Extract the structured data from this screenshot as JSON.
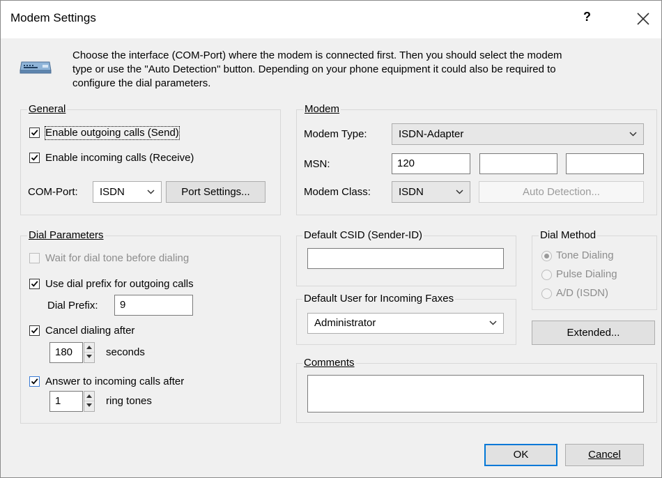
{
  "window": {
    "title": "Modem Settings",
    "help": "?"
  },
  "intro": {
    "icon": "modem-icon",
    "line1": "Choose the interface (COM-Port) where the modem is connected first. Then you should select the modem",
    "line2": "type or use the \"Auto Detection\" button. Depending on your phone equipment it could also be required to",
    "line3": "configure the dial parameters."
  },
  "general": {
    "legend": "General",
    "enable_outgoing": {
      "label": "Enable outgoing calls (Send)",
      "checked": true
    },
    "enable_incoming": {
      "label": "Enable incoming calls (Receive)",
      "checked": true
    },
    "com_port_label": "COM-Port:",
    "com_port_value": "ISDN",
    "port_settings_button": "Port Settings..."
  },
  "modem": {
    "legend": "Modem",
    "type_label": "Modem Type:",
    "type_value": "ISDN-Adapter",
    "msn_label": "MSN:",
    "msn_values": [
      "120",
      "",
      ""
    ],
    "class_label": "Modem Class:",
    "class_value": "ISDN",
    "auto_detection_button": "Auto Detection..."
  },
  "dial_parameters": {
    "legend": "Dial Parameters",
    "wait_dial_tone": {
      "label": "Wait for dial tone before dialing",
      "checked": false,
      "enabled": false
    },
    "use_prefix": {
      "label": "Use dial prefix for outgoing calls",
      "checked": true
    },
    "prefix_label": "Dial Prefix:",
    "prefix_value": "9",
    "cancel_dialing": {
      "label": "Cancel dialing after",
      "checked": true
    },
    "cancel_seconds": "180",
    "seconds_label": "seconds",
    "answer_incoming": {
      "label": "Answer to incoming calls after",
      "checked": true
    },
    "ring_tones_value": "1",
    "ring_tones_label": "ring tones"
  },
  "csid": {
    "legend": "Default CSID (Sender-ID)",
    "value": ""
  },
  "default_user": {
    "legend": "Default User for Incoming Faxes",
    "value": "Administrator"
  },
  "dial_method": {
    "legend": "Dial Method",
    "options": [
      {
        "label": "Tone Dialing",
        "selected": true
      },
      {
        "label": "Pulse Dialing",
        "selected": false
      },
      {
        "label": "A/D (ISDN)",
        "selected": false
      }
    ]
  },
  "extended_button": "Extended...",
  "comments": {
    "legend": "Comments",
    "value": ""
  },
  "footer": {
    "ok": "OK",
    "cancel": "Cancel"
  },
  "colors": {
    "accent": "#0078d7",
    "dialog_bg": "#f0f0f0",
    "checkbox_accent": "#3a7bd5"
  }
}
